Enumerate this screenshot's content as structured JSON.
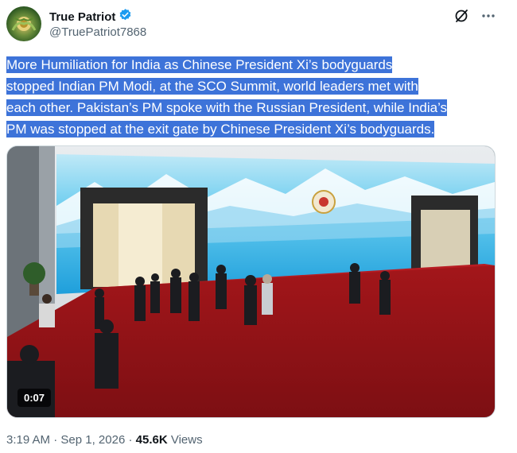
{
  "author": {
    "display_name": "True Patriot",
    "handle": "@TruePatriot7868",
    "verified_icon": "verified-badge-icon",
    "avatar_icon": "emblem-avatar"
  },
  "header_actions": {
    "grok_icon": "grok-slash-icon",
    "more_icon": "more-dots-icon"
  },
  "tweet": {
    "lines": [
      "More Humiliation for India as Chinese President Xi’s bodyguards",
      "stopped Indian PM Modi, at the SCO Summit, world leaders met with",
      "each other. Pakistan’s PM spoke with the Russian President, while India’s",
      "PM was stopped at the exit gate by Chinese President Xi’s bodyguards."
    ],
    "highlight_color": "#3d73d9"
  },
  "media": {
    "type": "video",
    "duration": "0:07"
  },
  "meta": {
    "time": "3:19 AM",
    "separator": " · ",
    "date": "Sep 1, 2026",
    "views_count": "45.6K",
    "views_label": "Views"
  }
}
